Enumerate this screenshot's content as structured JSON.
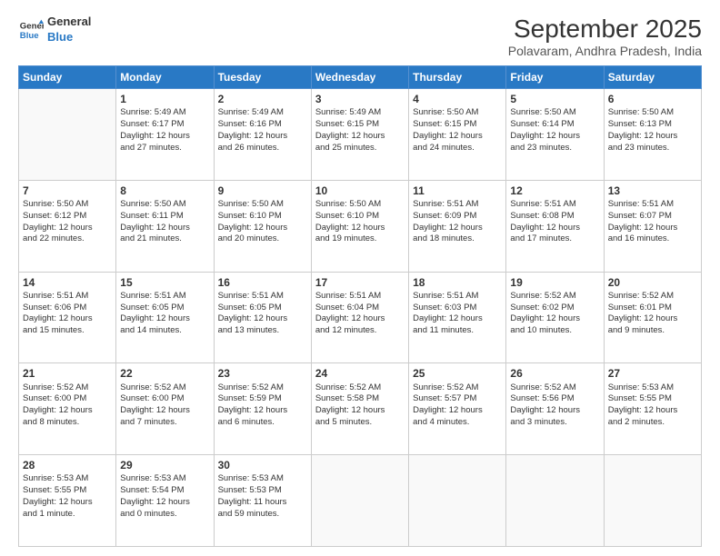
{
  "logo": {
    "line1": "General",
    "line2": "Blue"
  },
  "title": "September 2025",
  "subtitle": "Polavaram, Andhra Pradesh, India",
  "weekdays": [
    "Sunday",
    "Monday",
    "Tuesday",
    "Wednesday",
    "Thursday",
    "Friday",
    "Saturday"
  ],
  "days": [
    {
      "date": "",
      "info": ""
    },
    {
      "date": "1",
      "info": "Sunrise: 5:49 AM\nSunset: 6:17 PM\nDaylight: 12 hours\nand 27 minutes."
    },
    {
      "date": "2",
      "info": "Sunrise: 5:49 AM\nSunset: 6:16 PM\nDaylight: 12 hours\nand 26 minutes."
    },
    {
      "date": "3",
      "info": "Sunrise: 5:49 AM\nSunset: 6:15 PM\nDaylight: 12 hours\nand 25 minutes."
    },
    {
      "date": "4",
      "info": "Sunrise: 5:50 AM\nSunset: 6:15 PM\nDaylight: 12 hours\nand 24 minutes."
    },
    {
      "date": "5",
      "info": "Sunrise: 5:50 AM\nSunset: 6:14 PM\nDaylight: 12 hours\nand 23 minutes."
    },
    {
      "date": "6",
      "info": "Sunrise: 5:50 AM\nSunset: 6:13 PM\nDaylight: 12 hours\nand 23 minutes."
    },
    {
      "date": "7",
      "info": ""
    },
    {
      "date": "8",
      "info": "Sunrise: 5:50 AM\nSunset: 6:11 PM\nDaylight: 12 hours\nand 21 minutes."
    },
    {
      "date": "9",
      "info": "Sunrise: 5:50 AM\nSunset: 6:10 PM\nDaylight: 12 hours\nand 20 minutes."
    },
    {
      "date": "10",
      "info": "Sunrise: 5:50 AM\nSunset: 6:10 PM\nDaylight: 12 hours\nand 19 minutes."
    },
    {
      "date": "11",
      "info": "Sunrise: 5:51 AM\nSunset: 6:09 PM\nDaylight: 12 hours\nand 18 minutes."
    },
    {
      "date": "12",
      "info": "Sunrise: 5:51 AM\nSunset: 6:08 PM\nDaylight: 12 hours\nand 17 minutes."
    },
    {
      "date": "13",
      "info": "Sunrise: 5:51 AM\nSunset: 6:07 PM\nDaylight: 12 hours\nand 16 minutes."
    },
    {
      "date": "14",
      "info": ""
    },
    {
      "date": "15",
      "info": "Sunrise: 5:51 AM\nSunset: 6:05 PM\nDaylight: 12 hours\nand 14 minutes."
    },
    {
      "date": "16",
      "info": "Sunrise: 5:51 AM\nSunset: 6:05 PM\nDaylight: 12 hours\nand 13 minutes."
    },
    {
      "date": "17",
      "info": "Sunrise: 5:51 AM\nSunset: 6:04 PM\nDaylight: 12 hours\nand 12 minutes."
    },
    {
      "date": "18",
      "info": "Sunrise: 5:51 AM\nSunset: 6:03 PM\nDaylight: 12 hours\nand 11 minutes."
    },
    {
      "date": "19",
      "info": "Sunrise: 5:52 AM\nSunset: 6:02 PM\nDaylight: 12 hours\nand 10 minutes."
    },
    {
      "date": "20",
      "info": "Sunrise: 5:52 AM\nSunset: 6:01 PM\nDaylight: 12 hours\nand 9 minutes."
    },
    {
      "date": "21",
      "info": ""
    },
    {
      "date": "22",
      "info": "Sunrise: 5:52 AM\nSunset: 6:00 PM\nDaylight: 12 hours\nand 7 minutes."
    },
    {
      "date": "23",
      "info": "Sunrise: 5:52 AM\nSunset: 5:59 PM\nDaylight: 12 hours\nand 6 minutes."
    },
    {
      "date": "24",
      "info": "Sunrise: 5:52 AM\nSunset: 5:58 PM\nDaylight: 12 hours\nand 5 minutes."
    },
    {
      "date": "25",
      "info": "Sunrise: 5:52 AM\nSunset: 5:57 PM\nDaylight: 12 hours\nand 4 minutes."
    },
    {
      "date": "26",
      "info": "Sunrise: 5:52 AM\nSunset: 5:56 PM\nDaylight: 12 hours\nand 3 minutes."
    },
    {
      "date": "27",
      "info": "Sunrise: 5:53 AM\nSunset: 5:55 PM\nDaylight: 12 hours\nand 2 minutes."
    },
    {
      "date": "28",
      "info": ""
    },
    {
      "date": "29",
      "info": "Sunrise: 5:53 AM\nSunset: 5:54 PM\nDaylight: 12 hours\nand 0 minutes."
    },
    {
      "date": "30",
      "info": "Sunrise: 5:53 AM\nSunset: 5:53 PM\nDaylight: 11 hours\nand 59 minutes."
    },
    {
      "date": "",
      "info": ""
    },
    {
      "date": "",
      "info": ""
    },
    {
      "date": "",
      "info": ""
    },
    {
      "date": "",
      "info": ""
    }
  ],
  "row0_sunday_extra": "Sunrise: 5:50 AM\nSunset: 6:12 PM\nDaylight: 12 hours\nand 22 minutes.",
  "row2_sunday_extra": "Sunrise: 5:51 AM\nSunset: 6:06 PM\nDaylight: 12 hours\nand 15 minutes.",
  "row3_sunday_extra": "Sunrise: 5:52 AM\nSunset: 6:00 PM\nDaylight: 12 hours\nand 8 minutes.",
  "row4_sunday_extra": "Sunrise: 5:53 AM\nSunset: 5:55 PM\nDaylight: 12 hours\nand 1 minute."
}
